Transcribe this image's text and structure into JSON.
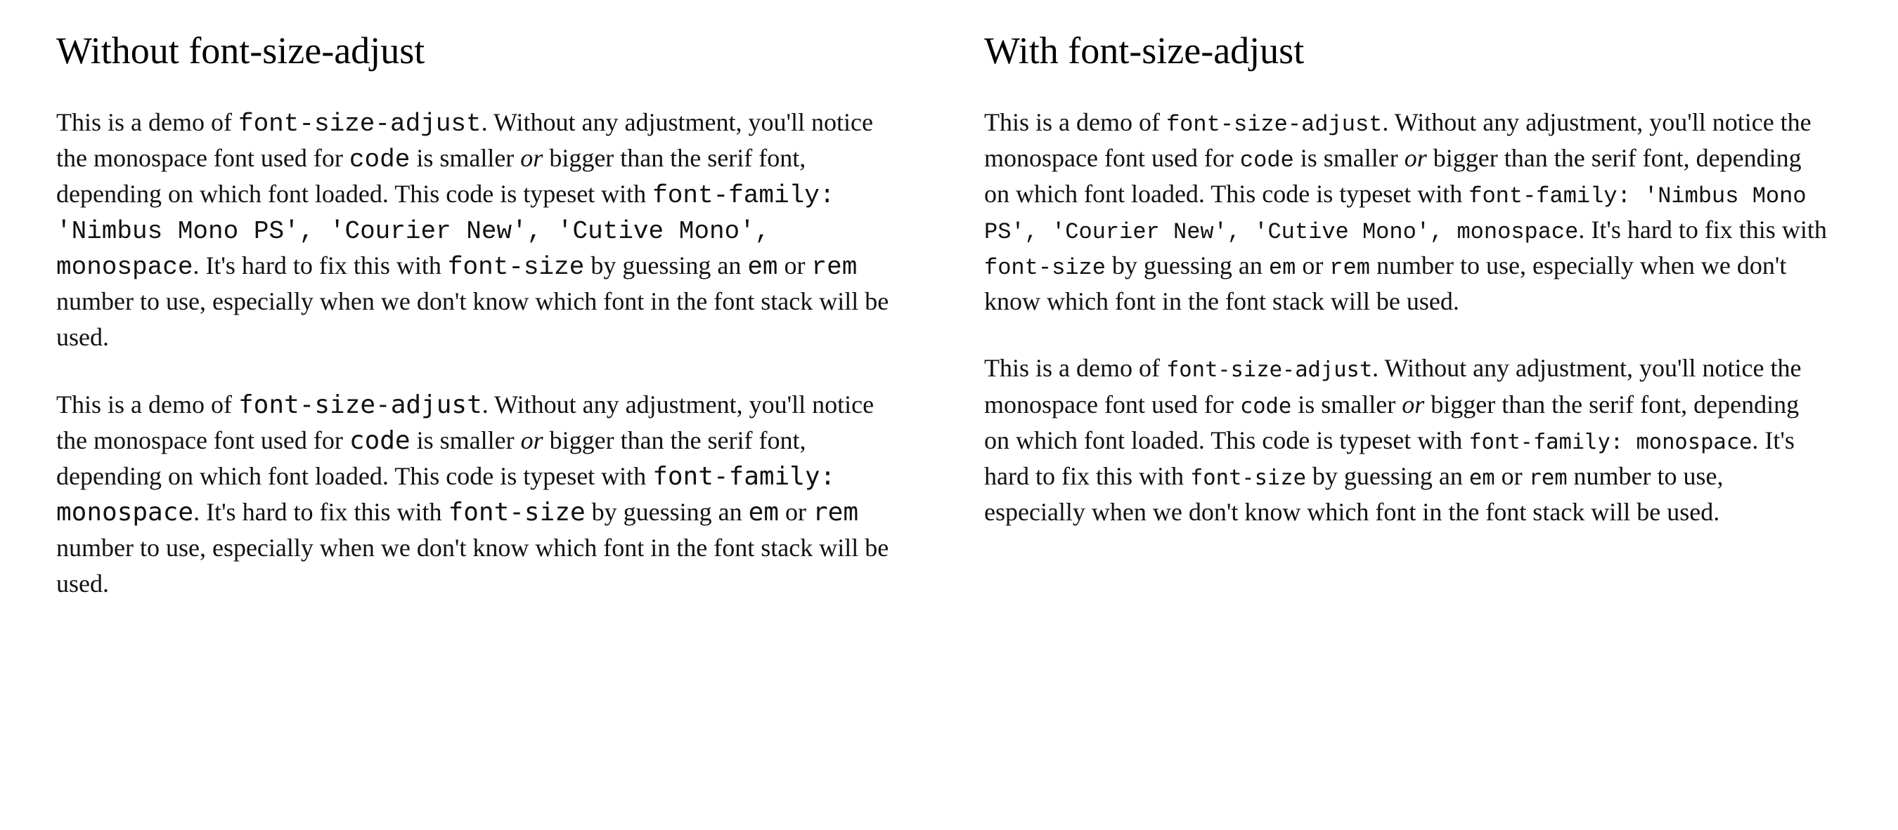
{
  "left": {
    "heading": "Without font-size-adjust",
    "para1": {
      "t1": "This is a demo of ",
      "c1": "font-size-adjust",
      "t2": ". Without any adjustment, you'll notice the monospace font used for ",
      "c2": "code",
      "t3": " is smaller ",
      "i1": "or",
      "t4": " bigger than the serif font, depending on which font loaded. This code is typeset with ",
      "c3": "font-family: 'Nimbus Mono PS', 'Courier New', 'Cutive Mono', monospace",
      "t5": ". It's hard to fix this with ",
      "c4": "font-size",
      "t6": " by guessing an ",
      "c5": "em",
      "t7": " or ",
      "c6": "rem",
      "t8": " number to use, especially when we don't know which font in the font stack will be used."
    },
    "para2": {
      "t1": "This is a demo of ",
      "c1": "font-size-adjust",
      "t2": ". Without any adjustment, you'll notice the monospace font used for ",
      "c2": "code",
      "t3": " is smaller ",
      "i1": "or",
      "t4": " bigger than the serif font, depending on which font loaded. This code is typeset with ",
      "c3": "font-family: monospace",
      "t5": ". It's hard to fix this with ",
      "c4": "font-size",
      "t6": " by guessing an ",
      "c5": "em",
      "t7": " or ",
      "c6": "rem",
      "t8": " number to use, especially when we don't know which font in the font stack will be used."
    }
  },
  "right": {
    "heading": "With font-size-adjust",
    "para1": {
      "t1": "This is a demo of ",
      "c1": "font-size-adjust",
      "t2": ". Without any adjustment, you'll notice the monospace font used for ",
      "c2": "code",
      "t3": " is smaller ",
      "i1": "or",
      "t4": " bigger than the serif font, depending on which font loaded. This code is typeset with ",
      "c3": "font-family: 'Nimbus Mono PS', 'Courier New', 'Cutive Mono', monospace",
      "t5": ". It's hard to fix this with ",
      "c4": "font-size",
      "t6": " by guessing an ",
      "c5": "em",
      "t7": " or ",
      "c6": "rem",
      "t8": " number to use, especially when we don't know which font in the font stack will be used."
    },
    "para2": {
      "t1": "This is a demo of ",
      "c1": "font-size-adjust",
      "t2": ". Without any adjustment, you'll notice the monospace font used for ",
      "c2": "code",
      "t3": " is smaller ",
      "i1": "or",
      "t4": " bigger than the serif font, depending on which font loaded. This code is typeset with ",
      "c3": "font-family: monospace",
      "t5": ". It's hard to fix this with ",
      "c4": "font-size",
      "t6": " by guessing an ",
      "c5": "em",
      "t7": " or ",
      "c6": "rem",
      "t8": " number to use, especially when we don't know which font in the font stack will be used."
    }
  }
}
